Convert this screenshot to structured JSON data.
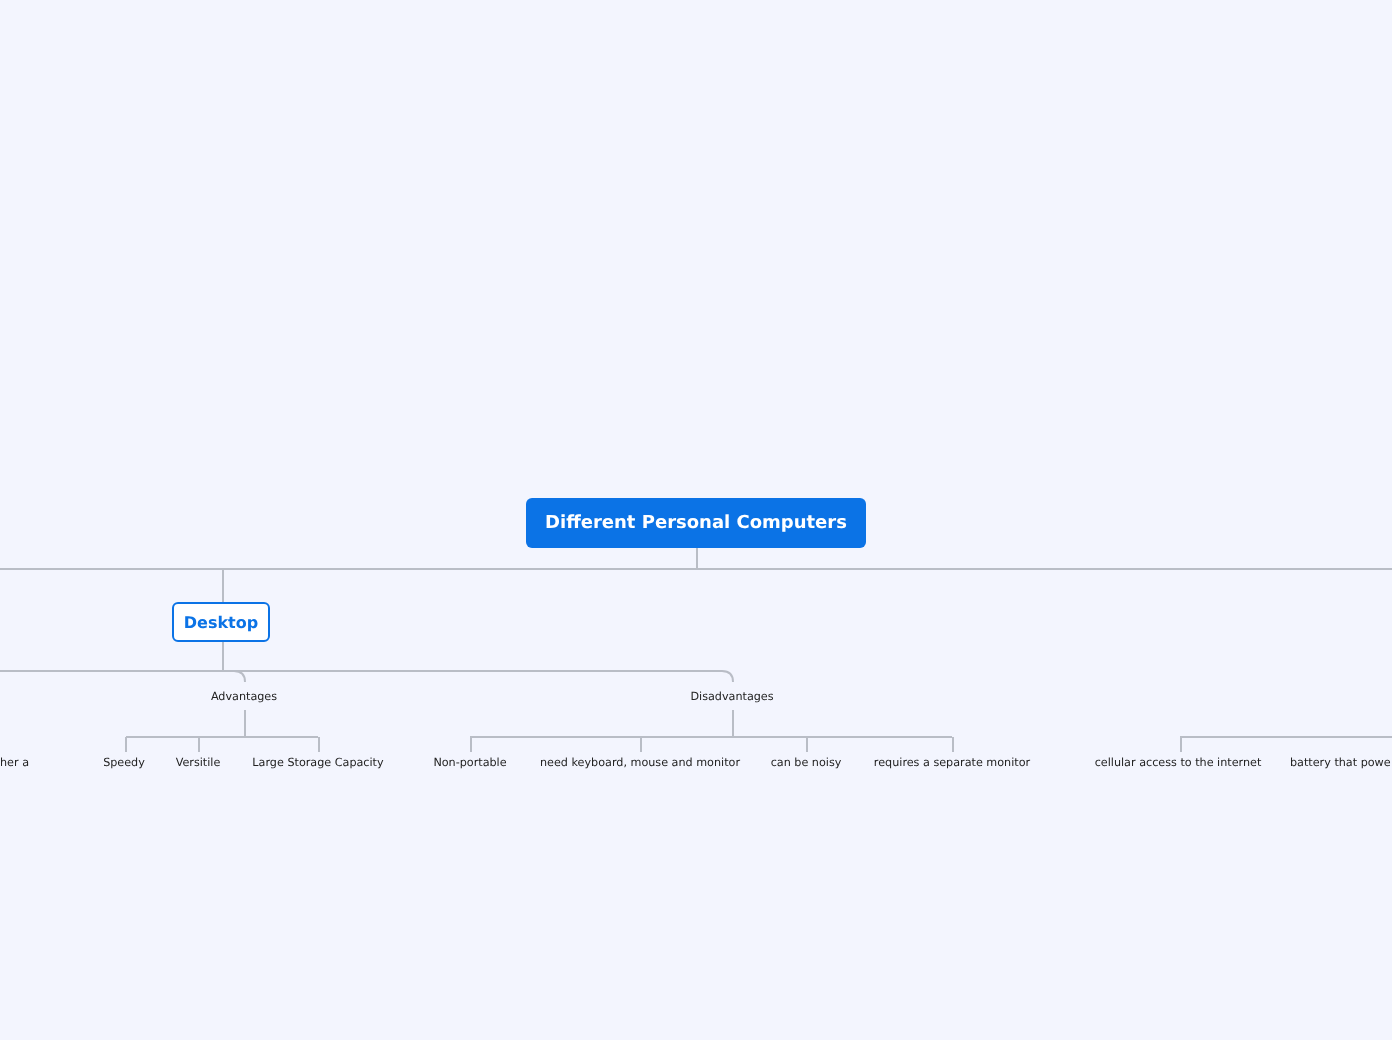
{
  "root": {
    "title": "Different Personal Computers",
    "children": [
      {
        "title": "Desktop",
        "children": [
          {
            "title": "Advantages",
            "children": [
              {
                "title": "Speedy"
              },
              {
                "title": "Versitile"
              },
              {
                "title": "Large Storage Capacity"
              }
            ]
          },
          {
            "title": "Disadvantages",
            "children": [
              {
                "title": "Non-portable"
              },
              {
                "title": "need keyboard, mouse and monitor"
              },
              {
                "title": "can be noisy"
              },
              {
                "title": "requires a separate monitor"
              }
            ]
          }
        ]
      }
    ]
  },
  "left_partial_topic": "her a",
  "right_partial_topics": [
    {
      "title": "cellular access to the internet"
    },
    {
      "title": "battery that powe"
    }
  ]
}
